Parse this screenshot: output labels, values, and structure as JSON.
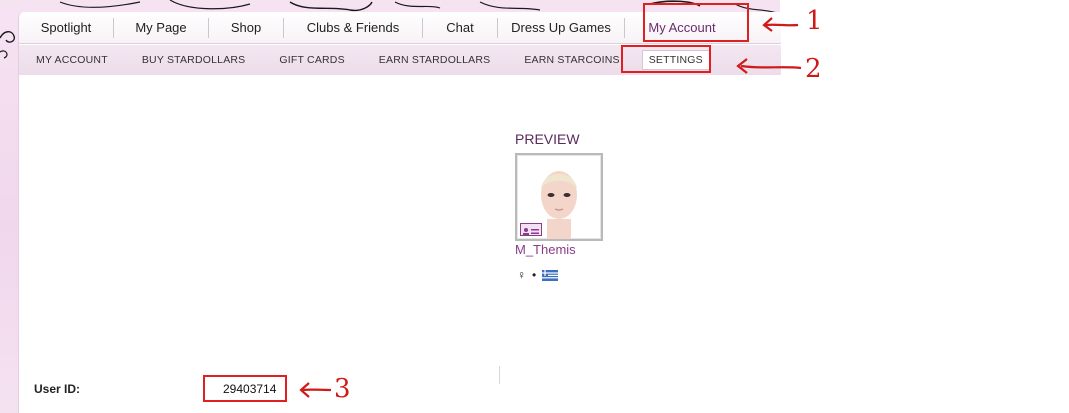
{
  "main_nav": {
    "items": [
      {
        "label": "Spotlight"
      },
      {
        "label": "My Page"
      },
      {
        "label": "Shop"
      },
      {
        "label": "Clubs & Friends"
      },
      {
        "label": "Chat"
      },
      {
        "label": "Dress Up Games"
      },
      {
        "label": "My Account",
        "active": true
      }
    ]
  },
  "sub_nav": {
    "items": [
      {
        "label": "MY ACCOUNT"
      },
      {
        "label": "BUY STARDOLLARS"
      },
      {
        "label": "GIFT CARDS"
      },
      {
        "label": "EARN STARDOLLARS"
      },
      {
        "label": "EARN STARCOINS"
      },
      {
        "label": "SETTINGS",
        "selected": true
      }
    ]
  },
  "preview": {
    "label": "PREVIEW",
    "username": "M_Themis",
    "gender_symbol": "♀",
    "separator": "•",
    "flag_icon": "greece-flag-icon"
  },
  "user": {
    "id_label": "User ID:",
    "id_value": "29403714"
  },
  "annotations": {
    "one": "1",
    "two": "2",
    "three": "3"
  },
  "colors": {
    "accent_purple": "#6a2d6b",
    "link_purple": "#8a3b8a",
    "annotation_red": "#e02020",
    "frame_pink": "#f1d7ec"
  }
}
